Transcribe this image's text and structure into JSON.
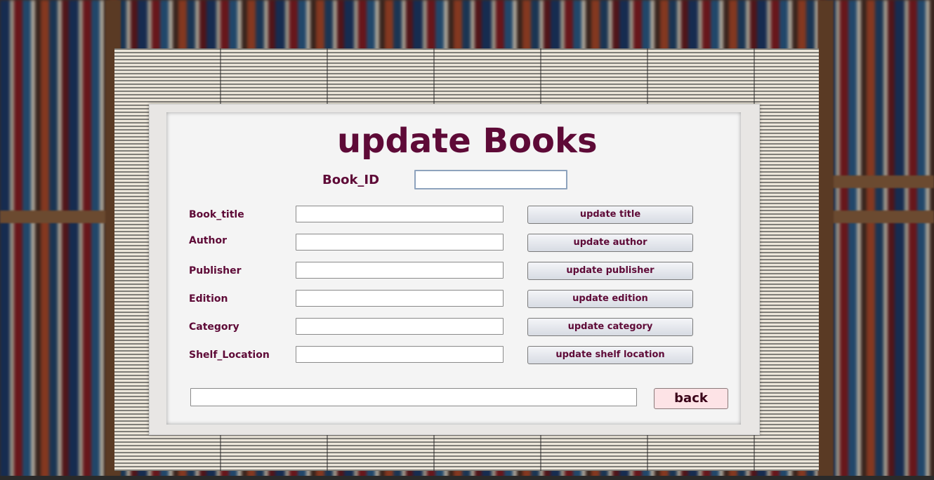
{
  "window": {
    "title": "update Books"
  },
  "book_id": {
    "label": "Book_ID",
    "value": ""
  },
  "fields": [
    {
      "label": "Book_title",
      "value": "",
      "button": "update title"
    },
    {
      "label": "Author",
      "value": "",
      "button": "update author"
    },
    {
      "label": "Publisher",
      "value": "",
      "button": "update publisher"
    },
    {
      "label": "Edition",
      "value": "",
      "button": "update edition"
    },
    {
      "label": "Category",
      "value": "",
      "button": "update category"
    },
    {
      "label": "Shelf_Location",
      "value": "",
      "button": "update shelf location"
    }
  ],
  "status": {
    "value": ""
  },
  "back_button": {
    "label": "back"
  },
  "colors": {
    "accent": "#5e0a37",
    "back_button_bg": "#fde3e6"
  }
}
